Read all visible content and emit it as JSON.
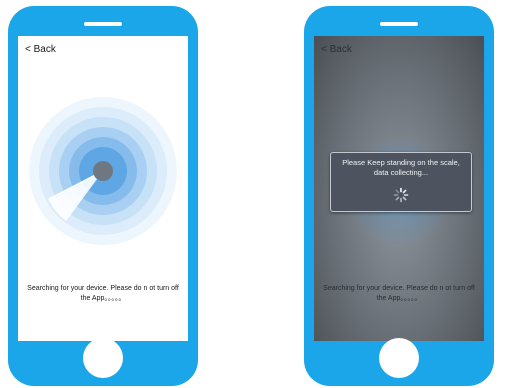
{
  "phones": {
    "left": {
      "back_label": "< Back",
      "status_text": "Searching for your device. Please do n ot turn off the App。。。。。"
    },
    "right": {
      "back_label": "< Back",
      "dialog_text": "Please Keep standing on the scale, data collecting...",
      "status_text": "Searching for your device. Please do n ot turn off the App。。。。。"
    }
  },
  "colors": {
    "phone_body": "#1ba6ea",
    "radar_blue": "#2f8fd8",
    "dialog_background": "#4d5460"
  },
  "icons": {
    "radar": "radar-sweep-icon",
    "spinner": "loading-spinner-icon"
  }
}
